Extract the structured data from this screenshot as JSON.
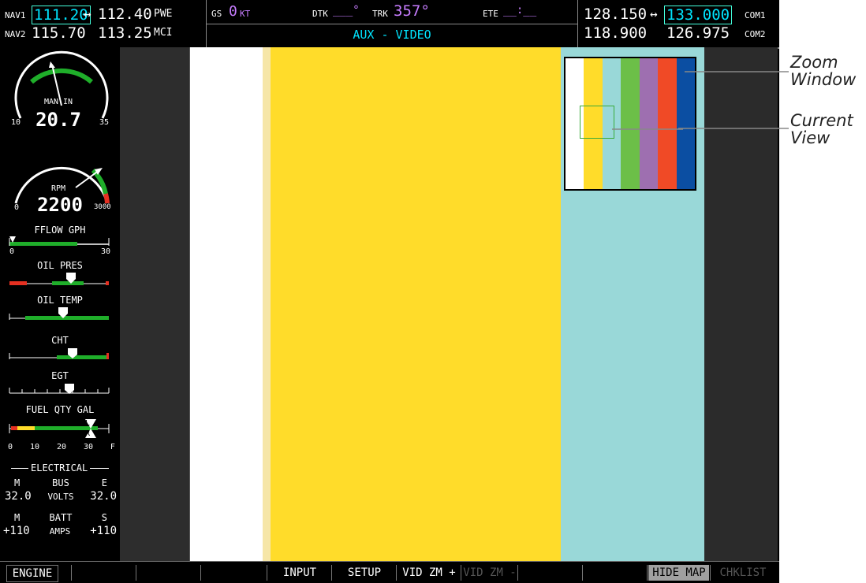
{
  "nav": {
    "nav1_label": "NAV1",
    "nav1_active": "111.20",
    "nav1_standby": "112.40",
    "nav1_id": "PWE",
    "nav2_label": "NAV2",
    "nav2_active": "115.70",
    "nav2_standby": "113.25",
    "nav2_id": "MCI",
    "swap": "↔"
  },
  "data_bar": {
    "gs_label": "GS",
    "gs_value": "0",
    "gs_unit": "KT",
    "dtk_label": "DTK",
    "dtk_value": "___°",
    "trk_label": "TRK",
    "trk_value": "357°",
    "ete_label": "ETE",
    "ete_value": "__:__",
    "page_title": "AUX - VIDEO"
  },
  "com": {
    "com1_active": "128.150",
    "com1_standby": "133.000",
    "com1_label": "COM1",
    "com2_active": "118.900",
    "com2_standby": "126.975",
    "com2_label": "COM2",
    "swap": "↔"
  },
  "engine": {
    "man_in": {
      "label": "MAN IN",
      "value": "20.7",
      "min": "10",
      "max": "35"
    },
    "rpm": {
      "label": "RPM",
      "value": "2200",
      "min": "0",
      "max": "3000"
    },
    "fflow": {
      "label": "FFLOW GPH",
      "min": "0",
      "max": "30"
    },
    "oil_pres": {
      "label": "OIL PRES"
    },
    "oil_temp": {
      "label": "OIL TEMP"
    },
    "cht": {
      "label": "CHT",
      "pointer": "1"
    },
    "egt": {
      "label": "EGT",
      "pointer": "1"
    },
    "fuel_qty": {
      "label": "FUEL QTY GAL",
      "ticks": [
        "0",
        "10",
        "20",
        "30",
        "F"
      ],
      "left": "L",
      "right": "R"
    },
    "electrical": {
      "header": "ELECTRICAL",
      "m": "M",
      "bus": "BUS",
      "e": "E",
      "volts_m": "32.0",
      "volts_label": "VOLTS",
      "volts_e": "32.0",
      "m2": "M",
      "batt": "BATT",
      "s": "S",
      "amps_m": "+110",
      "amps_label": "AMPS",
      "amps_s": "+110"
    }
  },
  "softkeys": [
    "ENGINE",
    "",
    "",
    "",
    "INPUT",
    "SETUP",
    "VID ZM +",
    "VID ZM -",
    "",
    "",
    "",
    "HIDE MAP",
    "CHKLIST"
  ],
  "callouts": {
    "zoom": "Zoom\nWindow",
    "current": "Current\nView"
  },
  "colors": {
    "bars": [
      "#ffffff",
      "#ffdc2a",
      "#99d8d8",
      "#6cbf48",
      "#9e6fb0",
      "#f04a26",
      "#0b4ea2"
    ]
  }
}
